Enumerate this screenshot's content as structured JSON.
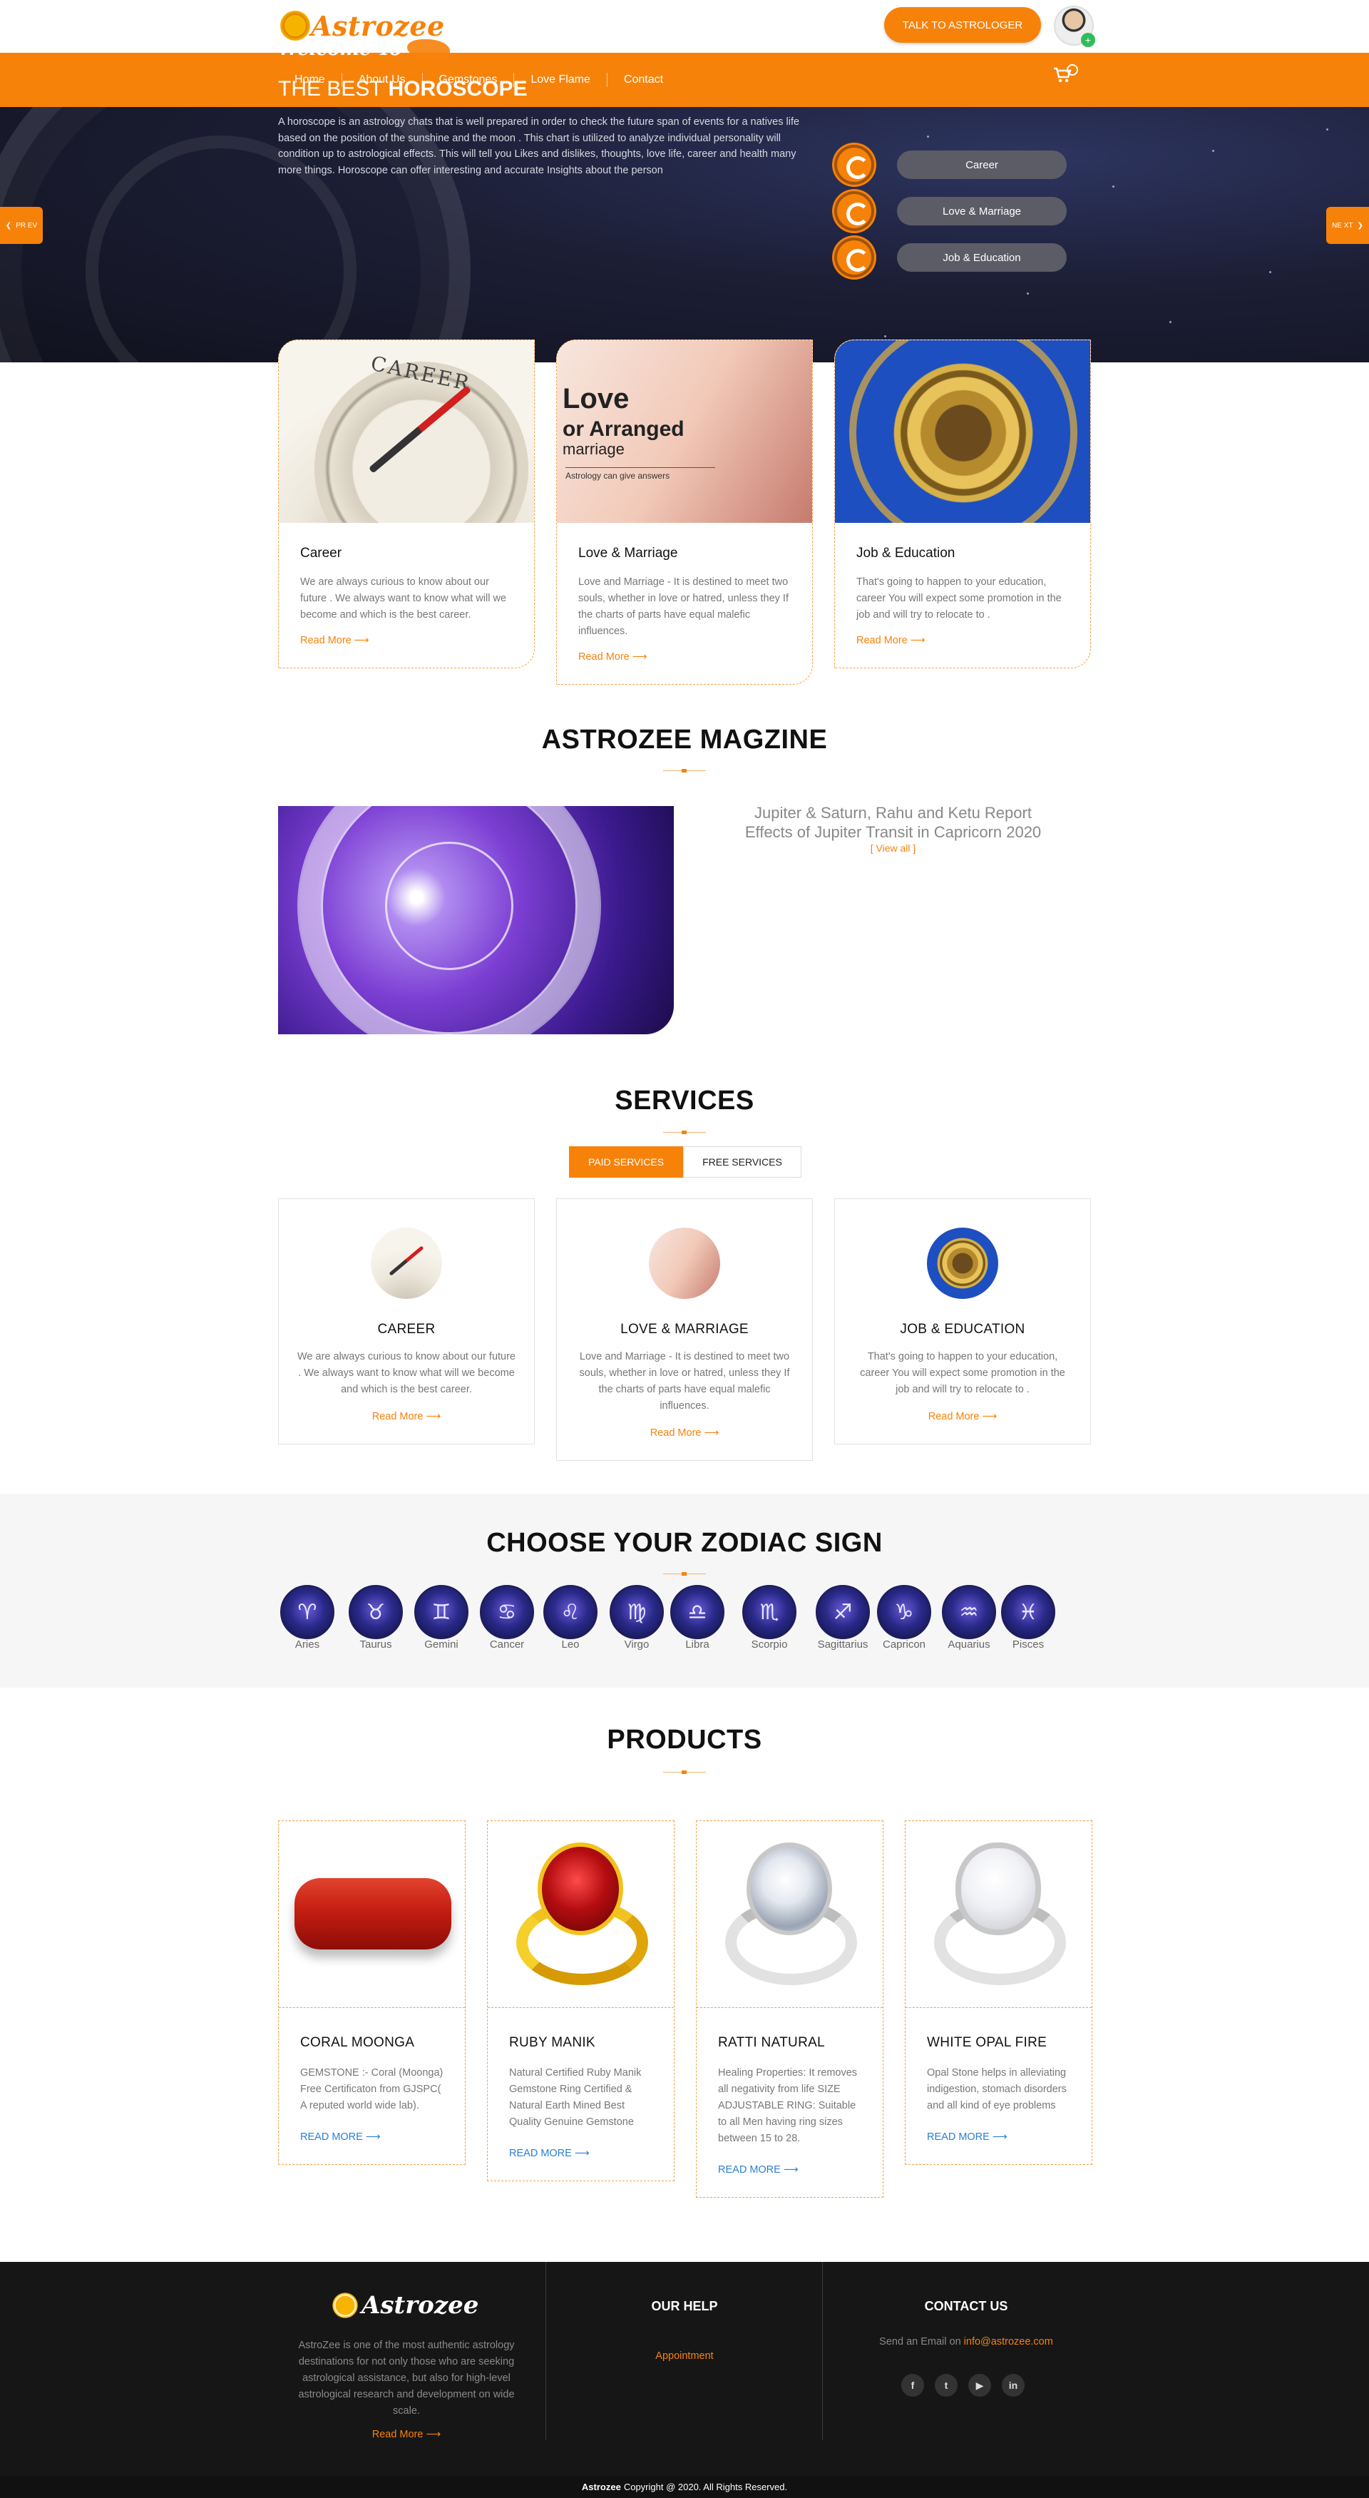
{
  "header": {
    "logo_text": "Astrozee",
    "cta_label": "TALK TO ASTROLOGER",
    "nav": [
      "Home",
      "About Us",
      "Gemstones",
      "Love Flame",
      "Contact"
    ]
  },
  "hero": {
    "welcome": "Welcome To",
    "title_prefix": "THE BEST",
    "title_bold": "HOROSCOPE",
    "text": "A horoscope is an astrology chats that is well prepared in order to check the future span of events for a natives life based on the position of the sunshine and the moon . This chart is utilized to analyze individual personality will condition up to astrological effects. This will tell you Likes and dislikes, thoughts, love life, career and health many more things. Horoscope can offer interesting and accurate Insights about the person",
    "items": [
      "Career",
      "Love & Marriage",
      "Job & Education"
    ],
    "prev_label": "PR EV",
    "next_label": "NE XT"
  },
  "features": [
    {
      "title": "Career",
      "text": "We are always curious to know about our future . We always want to know what will we become and which is the best career.",
      "more": "Read More ⟶",
      "img_text": "CAREER"
    },
    {
      "title": "Love & Marriage",
      "text": "Love and Marriage - It is destined to meet two souls, whether in love or hatred, unless they If the charts of parts have equal malefic influences.",
      "more": "Read More ⟶",
      "img_line1": "Love",
      "img_line2": "or Arranged",
      "img_line3": "marriage",
      "img_line4": "Astrology can give answers"
    },
    {
      "title": "Job & Education",
      "text": "That's going to happen to your education, career You will expect some promotion in the job and will try to relocate to .",
      "more": "Read More ⟶"
    }
  ],
  "magazine": {
    "title_light": "ASTROZEE",
    "title_bold": "MAGZINE",
    "line1": "Jupiter & Saturn, Rahu and Ketu Report",
    "line2": "Effects of Jupiter Transit in Capricorn 2020",
    "view_all": "[ View all ]"
  },
  "services": {
    "title": "SERVICES",
    "tabs": [
      "PAID SERVICES",
      "FREE SERVICES"
    ],
    "cards": [
      {
        "title": "CAREER",
        "text": "We are always curious to know about our future . We always want to know what will we become and which is the best career.",
        "more": "Read More ⟶"
      },
      {
        "title": "LOVE & MARRIAGE",
        "text": "Love and Marriage - It is destined to meet two souls, whether in love or hatred, unless they If the charts of parts have equal malefic influences.",
        "more": "Read More ⟶"
      },
      {
        "title": "JOB & EDUCATION",
        "text": "That's going to happen to your education, career You will expect some promotion in the job and will try to relocate to .",
        "more": "Read More ⟶"
      }
    ]
  },
  "zodiac": {
    "title_light": "CHOOSE YOUR",
    "title_bold": "ZODIAC SIGN",
    "signs": [
      {
        "name": "Aries",
        "sym": "♈"
      },
      {
        "name": "Taurus",
        "sym": "♉"
      },
      {
        "name": "Gemini",
        "sym": "♊"
      },
      {
        "name": "Cancer",
        "sym": "♋"
      },
      {
        "name": "Leo",
        "sym": "♌"
      },
      {
        "name": "Virgo",
        "sym": "♍"
      },
      {
        "name": "Libra",
        "sym": "♎"
      },
      {
        "name": "Scorpio",
        "sym": "♏"
      },
      {
        "name": "Sagittarius",
        "sym": "♐"
      },
      {
        "name": "Capricon",
        "sym": "♑"
      },
      {
        "name": "Aquarius",
        "sym": "♒"
      },
      {
        "name": "Pisces",
        "sym": "♓"
      }
    ]
  },
  "products": {
    "title": "PRODUCTS",
    "items": [
      {
        "title": "CORAL MOONGA",
        "text": "GEMSTONE :- Coral (Moonga) Free Certificaton from GJSPC( A reputed world wide lab).",
        "more": "READ MORE ⟶"
      },
      {
        "title": "RUBY MANIK",
        "text": "Natural Certified Ruby Manik Gemstone Ring Certified & Natural Earth Mined Best Quality Genuine Gemstone",
        "more": "READ MORE ⟶"
      },
      {
        "title": "RATTI NATURAL",
        "text": "Healing Properties: It removes all negativity from life SIZE ADJUSTABLE RING: Suitable to all Men having ring sizes between 15 to 28.",
        "more": "READ MORE ⟶"
      },
      {
        "title": "WHITE OPAL FIRE",
        "text": "Opal Stone helps in alleviating indigestion, stomach disorders and all kind of eye problems",
        "more": "READ MORE ⟶"
      }
    ]
  },
  "footer": {
    "logo_text": "Astrozee",
    "about": "AstroZee is one of the most authentic astrology destinations for not only those who are seeking astrological assistance, but also for high-level astrological research and development on wide scale.",
    "read_more": "Read More ⟶",
    "help_title": "OUR HELP",
    "help_link": "Appointment",
    "contact_title_light": "CONTACT",
    "contact_title_bold": "US",
    "email_prefix": "Send an Email on",
    "email": "info@astrozee.com",
    "socials": [
      "f",
      "t",
      "▶",
      "in"
    ],
    "copyright_brand": "Astrozee",
    "copyright_text": "Copyright @ 2020. All Rights Reserved."
  },
  "colors": {
    "accent": "#f7820a",
    "footer_bg": "#161616",
    "link_blue": "#2a7fd4"
  }
}
